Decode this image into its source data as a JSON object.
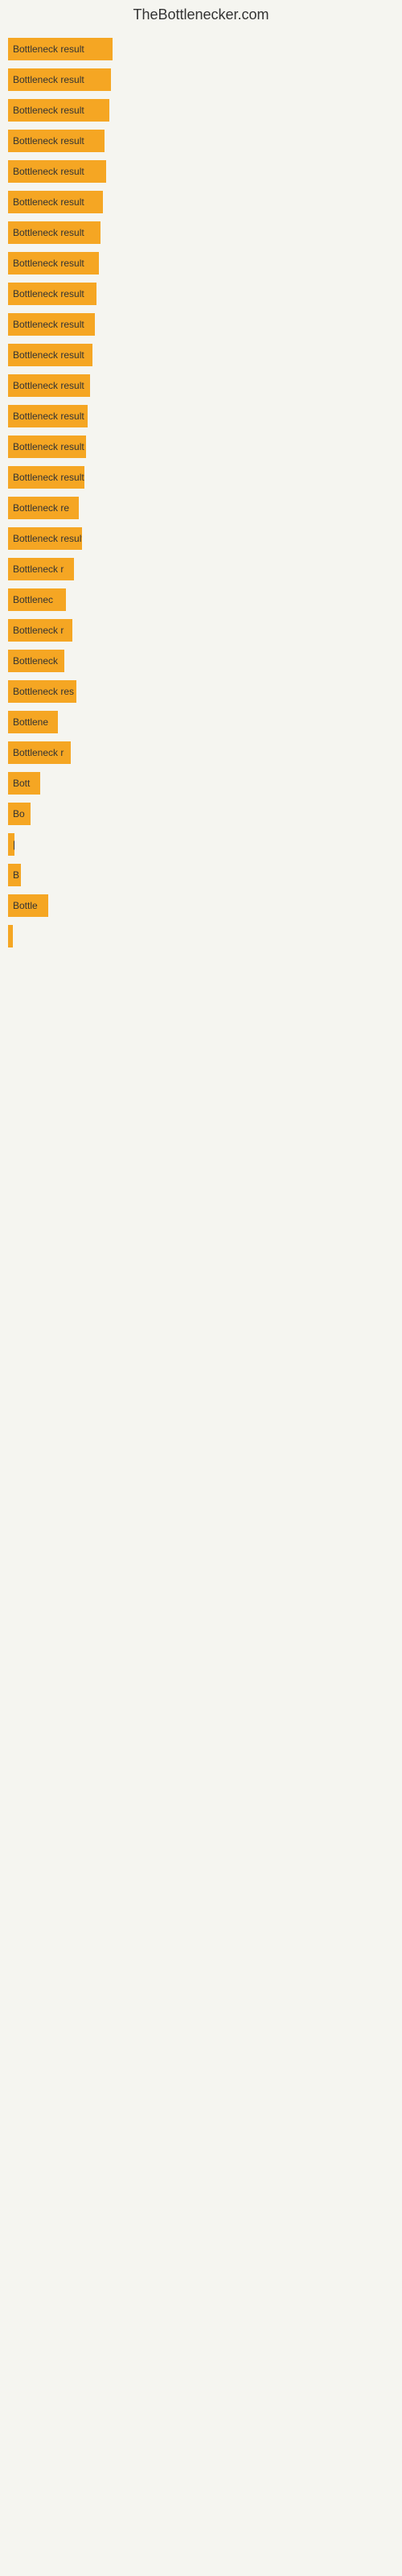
{
  "site": {
    "title": "TheBottlenecker.com"
  },
  "bars": [
    {
      "label": "Bottleneck result",
      "width": 130
    },
    {
      "label": "Bottleneck result",
      "width": 128
    },
    {
      "label": "Bottleneck result",
      "width": 126
    },
    {
      "label": "Bottleneck result",
      "width": 120
    },
    {
      "label": "Bottleneck result",
      "width": 122
    },
    {
      "label": "Bottleneck result",
      "width": 118
    },
    {
      "label": "Bottleneck result",
      "width": 115
    },
    {
      "label": "Bottleneck result",
      "width": 113
    },
    {
      "label": "Bottleneck result",
      "width": 110
    },
    {
      "label": "Bottleneck result",
      "width": 108
    },
    {
      "label": "Bottleneck result",
      "width": 105
    },
    {
      "label": "Bottleneck result",
      "width": 102
    },
    {
      "label": "Bottleneck result",
      "width": 99
    },
    {
      "label": "Bottleneck result",
      "width": 97
    },
    {
      "label": "Bottleneck result",
      "width": 95
    },
    {
      "label": "Bottleneck re",
      "width": 88
    },
    {
      "label": "Bottleneck result",
      "width": 92
    },
    {
      "label": "Bottleneck r",
      "width": 82
    },
    {
      "label": "Bottlenec",
      "width": 72
    },
    {
      "label": "Bottleneck r",
      "width": 80
    },
    {
      "label": "Bottleneck",
      "width": 70
    },
    {
      "label": "Bottleneck res",
      "width": 85
    },
    {
      "label": "Bottlene",
      "width": 62
    },
    {
      "label": "Bottleneck r",
      "width": 78
    },
    {
      "label": "Bott",
      "width": 40
    },
    {
      "label": "Bo",
      "width": 28
    },
    {
      "label": "|",
      "width": 8
    },
    {
      "label": "B",
      "width": 16
    },
    {
      "label": "Bottle",
      "width": 50
    },
    {
      "label": "|",
      "width": 6
    }
  ]
}
